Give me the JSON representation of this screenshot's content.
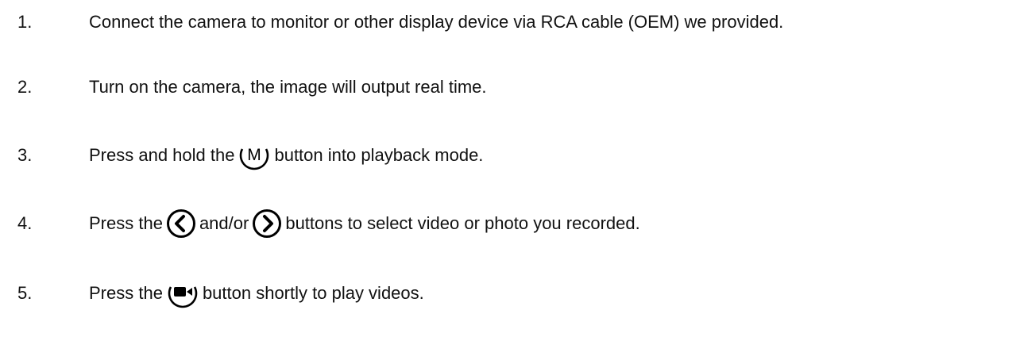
{
  "steps": [
    {
      "number": "1.",
      "text": "Connect the camera to monitor or other display device via RCA cable (OEM) we provided."
    },
    {
      "number": "2.",
      "text": "Turn on the camera, the image will output real time."
    },
    {
      "number": "3.",
      "before": "Press and hold the",
      "icon": "mode-m-button-icon",
      "icon_letter": "M",
      "after": "button into playback mode."
    },
    {
      "number": "4.",
      "before": "Press the",
      "icon1": "left-arrow-button-icon",
      "middle": "and/or",
      "icon2": "right-arrow-button-icon",
      "after": "buttons to select video or photo you recorded."
    },
    {
      "number": "5.",
      "before": "Press the",
      "icon": "video-record-button-icon",
      "after": "button shortly to play videos."
    }
  ]
}
